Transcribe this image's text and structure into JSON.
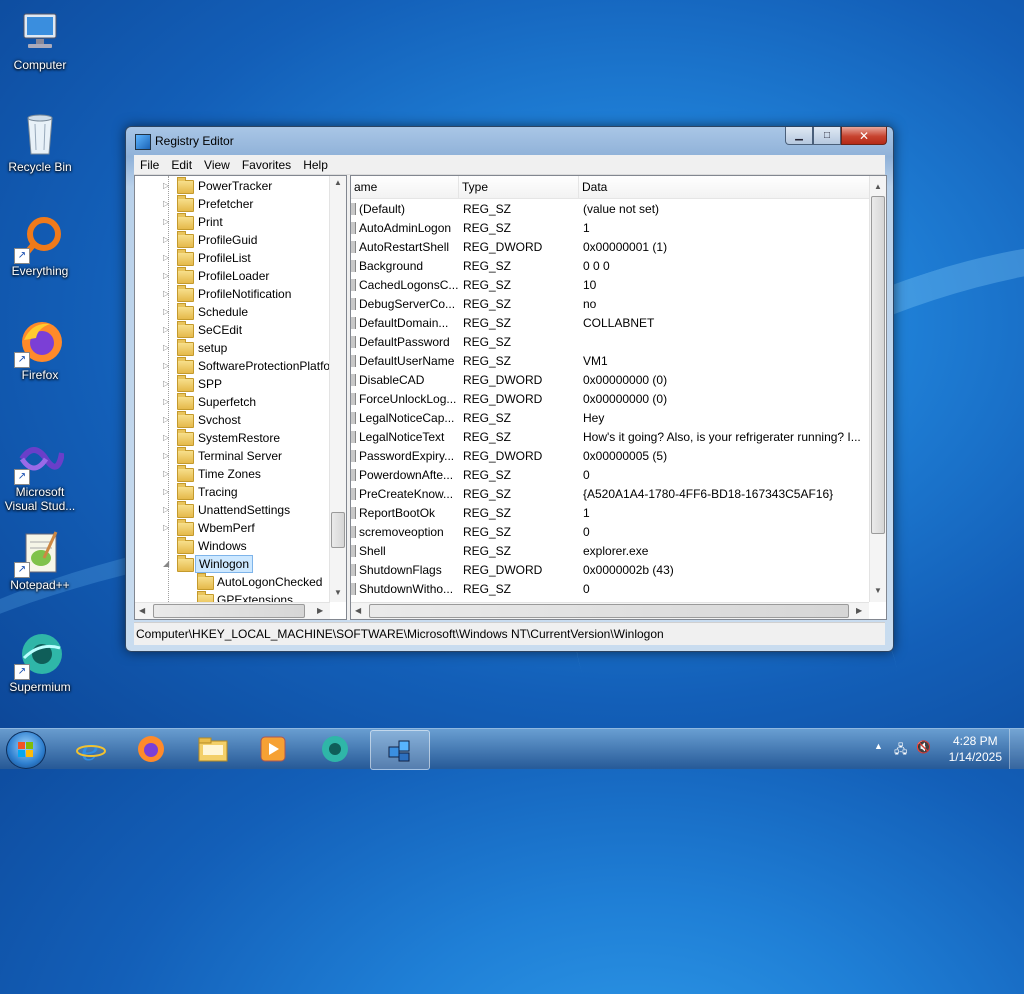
{
  "desktop": {
    "icons": [
      {
        "label": "Computer",
        "icon": "computer-icon"
      },
      {
        "label": "Recycle Bin",
        "icon": "recycle-bin-icon"
      },
      {
        "label": "Everything",
        "icon": "everything-search-icon"
      },
      {
        "label": "Firefox",
        "icon": "firefox-icon"
      },
      {
        "label": "Microsoft Visual Stud...",
        "icon": "visual-studio-icon"
      },
      {
        "label": "Notepad++",
        "icon": "notepad-plus-plus-icon"
      },
      {
        "label": "Supermium",
        "icon": "supermium-icon"
      }
    ]
  },
  "window": {
    "title": "Registry Editor",
    "menu": [
      "File",
      "Edit",
      "View",
      "Favorites",
      "Help"
    ],
    "tree": {
      "items": [
        "PowerTracker",
        "Prefetcher",
        "Print",
        "ProfileGuid",
        "ProfileList",
        "ProfileLoader",
        "ProfileNotification",
        "Schedule",
        "SeCEdit",
        "setup",
        "SoftwareProtectionPlatfo",
        "SPP",
        "Superfetch",
        "Svchost",
        "SystemRestore",
        "Terminal Server",
        "Time Zones",
        "Tracing",
        "UnattendSettings",
        "WbemPerf",
        "Windows"
      ],
      "selected": "Winlogon",
      "children": [
        "AutoLogonChecked",
        "GPExtensions"
      ]
    },
    "list": {
      "columns": {
        "name": "ame",
        "type": "Type",
        "data": "Data"
      },
      "rows": [
        {
          "name": "(Default)",
          "type": "REG_SZ",
          "data": "(value not set)"
        },
        {
          "name": "AutoAdminLogon",
          "type": "REG_SZ",
          "data": "1"
        },
        {
          "name": "AutoRestartShell",
          "type": "REG_DWORD",
          "data": "0x00000001 (1)"
        },
        {
          "name": "Background",
          "type": "REG_SZ",
          "data": "0 0 0"
        },
        {
          "name": "CachedLogonsC...",
          "type": "REG_SZ",
          "data": "10"
        },
        {
          "name": "DebugServerCo...",
          "type": "REG_SZ",
          "data": "no"
        },
        {
          "name": "DefaultDomain...",
          "type": "REG_SZ",
          "data": "COLLABNET"
        },
        {
          "name": "DefaultPassword",
          "type": "REG_SZ",
          "data": ""
        },
        {
          "name": "DefaultUserName",
          "type": "REG_SZ",
          "data": "VM1"
        },
        {
          "name": "DisableCAD",
          "type": "REG_DWORD",
          "data": "0x00000000 (0)"
        },
        {
          "name": "ForceUnlockLog...",
          "type": "REG_DWORD",
          "data": "0x00000000 (0)"
        },
        {
          "name": "LegalNoticeCap...",
          "type": "REG_SZ",
          "data": "Hey"
        },
        {
          "name": "LegalNoticeText",
          "type": "REG_SZ",
          "data": "How's it going? Also, is your refrigerater running? I..."
        },
        {
          "name": "PasswordExpiry...",
          "type": "REG_DWORD",
          "data": "0x00000005 (5)"
        },
        {
          "name": "PowerdownAfte...",
          "type": "REG_SZ",
          "data": "0"
        },
        {
          "name": "PreCreateKnow...",
          "type": "REG_SZ",
          "data": "{A520A1A4-1780-4FF6-BD18-167343C5AF16}"
        },
        {
          "name": "ReportBootOk",
          "type": "REG_SZ",
          "data": "1"
        },
        {
          "name": "scremoveoption",
          "type": "REG_SZ",
          "data": "0"
        },
        {
          "name": "Shell",
          "type": "REG_SZ",
          "data": "explorer.exe"
        },
        {
          "name": "ShutdownFlags",
          "type": "REG_DWORD",
          "data": "0x0000002b (43)"
        },
        {
          "name": "ShutdownWitho...",
          "type": "REG_SZ",
          "data": "0"
        }
      ]
    },
    "status": "Computer\\HKEY_LOCAL_MACHINE\\SOFTWARE\\Microsoft\\Windows NT\\CurrentVersion\\Winlogon"
  },
  "taskbar": {
    "apps": [
      "internet-explorer-icon",
      "firefox-icon",
      "file-explorer-icon",
      "media-player-icon",
      "supermium-icon",
      "registry-editor-icon"
    ],
    "clock": {
      "time": "4:28 PM",
      "date": "1/14/2025"
    }
  }
}
